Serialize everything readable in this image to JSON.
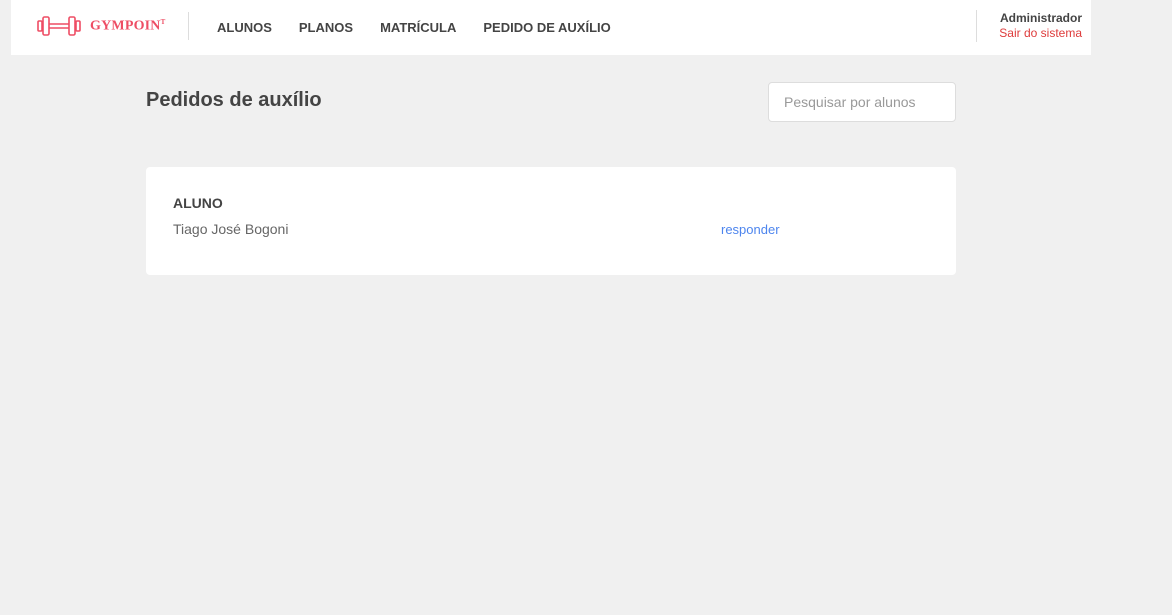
{
  "header": {
    "brand": "GYMPOIN",
    "brand_mark": "T",
    "logo_icon": "dumbbell-icon",
    "accent_color": "#ee4d64",
    "nav": [
      {
        "label": "ALUNOS"
      },
      {
        "label": "PLANOS"
      },
      {
        "label": "MATRÍCULA"
      },
      {
        "label": "PEDIDO DE AUXÍLIO"
      }
    ],
    "user": {
      "name": "Administrador",
      "logout_label": "Sair do sistema"
    }
  },
  "main": {
    "title": "Pedidos de auxílio",
    "search": {
      "placeholder": "Pesquisar por alunos",
      "value": ""
    },
    "table": {
      "columns": [
        "ALUNO"
      ],
      "rows": [
        {
          "student": "Tiago José Bogoni",
          "action_label": "responder"
        }
      ],
      "link_color": "#4d85ee"
    }
  }
}
